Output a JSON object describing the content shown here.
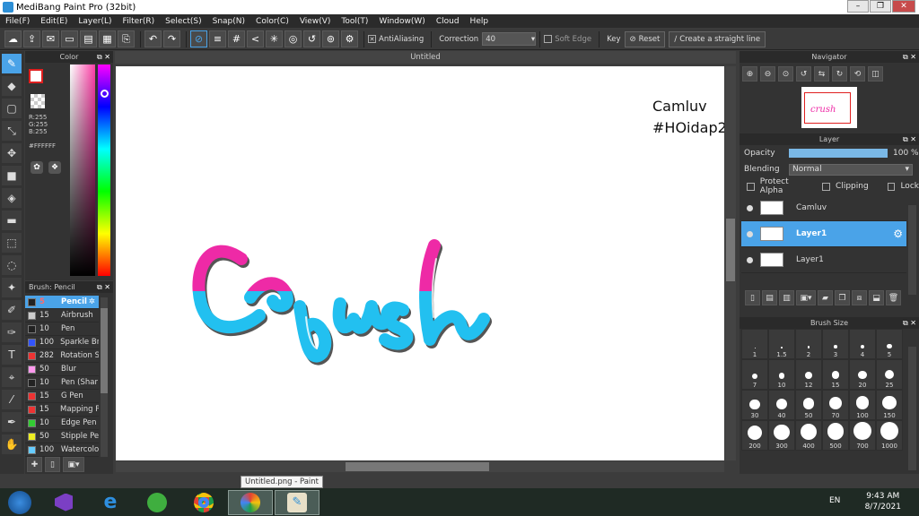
{
  "window": {
    "title": "MediBang Paint Pro (32bit)"
  },
  "menu": [
    "File(F)",
    "Edit(E)",
    "Layer(L)",
    "Filter(R)",
    "Select(S)",
    "Snap(N)",
    "Color(C)",
    "View(V)",
    "Tool(T)",
    "Window(W)",
    "Cloud",
    "Help"
  ],
  "toolbar": {
    "antialiasing_label": "AntiAliasing",
    "correction_label": "Correction",
    "correction_value": "40",
    "soft_edge_label": "Soft Edge",
    "key_label": "Key",
    "reset_label": "Reset",
    "straight_line_label": "Create a straight line"
  },
  "color_panel": {
    "title": "Color",
    "r": "R:255",
    "g": "G:255",
    "b": "B:255",
    "hex": "#FFFFFF"
  },
  "brush_panel": {
    "title": "Brush: Pencil",
    "brushes": [
      {
        "size": "5",
        "name": "Pencil",
        "color": "#222222",
        "active": true
      },
      {
        "size": "15",
        "name": "Airbrush",
        "color": "#cccccc"
      },
      {
        "size": "10",
        "name": "Pen",
        "color": "#222222"
      },
      {
        "size": "100",
        "name": "Sparkle Br",
        "color": "#3355ff"
      },
      {
        "size": "282",
        "name": "Rotation S",
        "color": "#ee3333"
      },
      {
        "size": "50",
        "name": "Blur",
        "color": "#ff99ee"
      },
      {
        "size": "10",
        "name": "Pen (Shar",
        "color": "#222222"
      },
      {
        "size": "15",
        "name": "G Pen",
        "color": "#ee3333"
      },
      {
        "size": "15",
        "name": "Mapping P",
        "color": "#ee3333"
      },
      {
        "size": "10",
        "name": "Edge Pen",
        "color": "#33cc33"
      },
      {
        "size": "50",
        "name": "Stipple Pe",
        "color": "#eeee22"
      },
      {
        "size": "100",
        "name": "Watercolo",
        "color": "#66ccff"
      }
    ]
  },
  "canvas": {
    "tab_title": "Untitled",
    "text_line1": "Camluv",
    "text_line2": "#HOidap2"
  },
  "navigator": {
    "title": "Navigator"
  },
  "layer_panel": {
    "title": "Layer",
    "opacity_label": "Opacity",
    "opacity_value": "100 %",
    "blending_label": "Blending",
    "blending_value": "Normal",
    "protect_alpha": "Protect Alpha",
    "clipping": "Clipping",
    "lock": "Lock",
    "layers": [
      {
        "name": "Camluv",
        "active": false
      },
      {
        "name": "Layer1",
        "active": true
      },
      {
        "name": "Layer1",
        "active": false
      }
    ]
  },
  "brush_size": {
    "title": "Brush Size",
    "sizes": [
      "1",
      "1.5",
      "2",
      "3",
      "4",
      "5",
      "7",
      "10",
      "12",
      "15",
      "20",
      "25",
      "30",
      "40",
      "50",
      "70",
      "100",
      "150",
      "200",
      "300",
      "400",
      "500",
      "700",
      "1000"
    ]
  },
  "taskbar": {
    "tooltip": "Untitled.png - Paint",
    "lang": "EN",
    "time": "9:43 AM",
    "date": "8/7/2021"
  }
}
